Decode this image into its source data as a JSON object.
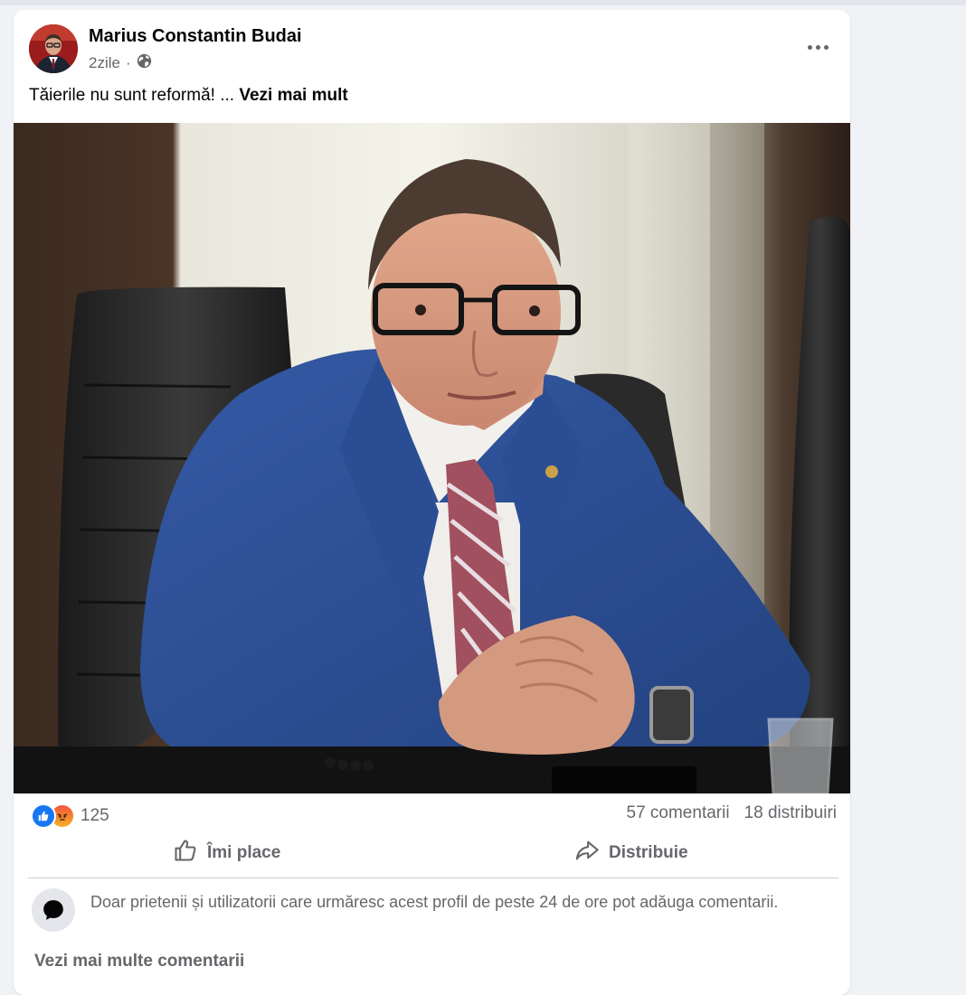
{
  "post": {
    "author": "Marius Constantin Budai",
    "time": "2zile",
    "separator": "·",
    "audience_icon": "globe-icon",
    "more_icon": "more-options-icon",
    "text": "Tăierile nu sunt reformă! ...",
    "see_more": "Vezi mai mult"
  },
  "stats": {
    "reaction_icons": [
      "like-reaction-icon",
      "angry-reaction-icon"
    ],
    "reaction_count": "125",
    "comments": "57 comentarii",
    "shares": "18 distribuiri"
  },
  "actions": {
    "like": "Îmi place",
    "share": "Distribuie"
  },
  "comment_notice": "Doar prietenii și utilizatorii care urmăresc acest profil de peste 24 de ore pot adăuga comentarii.",
  "view_more_comments": "Vezi mai multe comentarii",
  "colors": {
    "background": "#f0f2f5",
    "card": "#ffffff",
    "secondary_text": "#65676b",
    "like_blue": "#1877f2",
    "suit_blue": "#2a4d97"
  }
}
